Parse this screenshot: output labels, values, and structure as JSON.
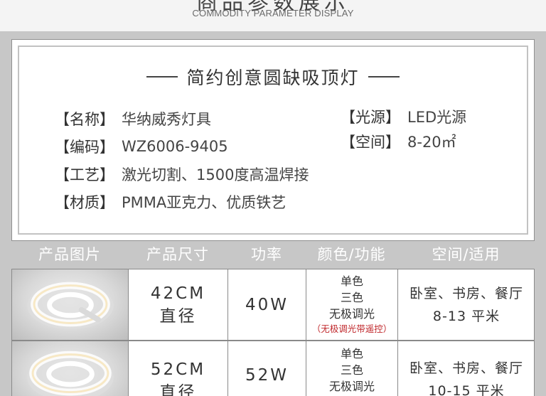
{
  "header": {
    "cn_title_clipped": "商品参数展示",
    "en_subtitle": "COMMODITY PARAMETER DISPLAY"
  },
  "card": {
    "title": "简约创意圆缺吸顶灯",
    "specs": [
      {
        "key": "【名称】",
        "value": "华纳威秀灯具"
      },
      {
        "key": "【编码】",
        "value": "WZ6006-9405"
      },
      {
        "key": "【工艺】",
        "value": "激光切割、1500度高温焊接"
      },
      {
        "key": "【材质】",
        "value": "PMMA亚克力、优质铁艺"
      },
      {
        "key": "【光源】",
        "value": "LED光源"
      },
      {
        "key": "【空间】",
        "value": "8-20㎡"
      }
    ]
  },
  "table": {
    "headers": [
      "产品图片",
      "产品尺寸",
      "功率",
      "颜色/功能",
      "空间/适用"
    ],
    "rows": [
      {
        "image_icon": "ring-lamp-photo",
        "size_value": "42CM",
        "size_label": "直径",
        "power": "40W",
        "color_lines": [
          "单色",
          "三色",
          "无极调光"
        ],
        "color_note": "（无极调光带遥控）",
        "rooms": "卧室、书房、餐厅",
        "area": "8-13 平米"
      },
      {
        "image_icon": "ring-lamp-photo",
        "size_value": "52CM",
        "size_label": "直径",
        "power": "52W",
        "color_lines": [
          "单色",
          "三色",
          "无极调光"
        ],
        "color_note": "",
        "rooms": "卧室、书房、餐厅",
        "area": "10-15 平米"
      }
    ]
  },
  "colors": {
    "page_bg": "#c7c7c7",
    "card_bg": "#ffffff",
    "header_text": "#ffffff",
    "note_red": "#c0282c"
  }
}
